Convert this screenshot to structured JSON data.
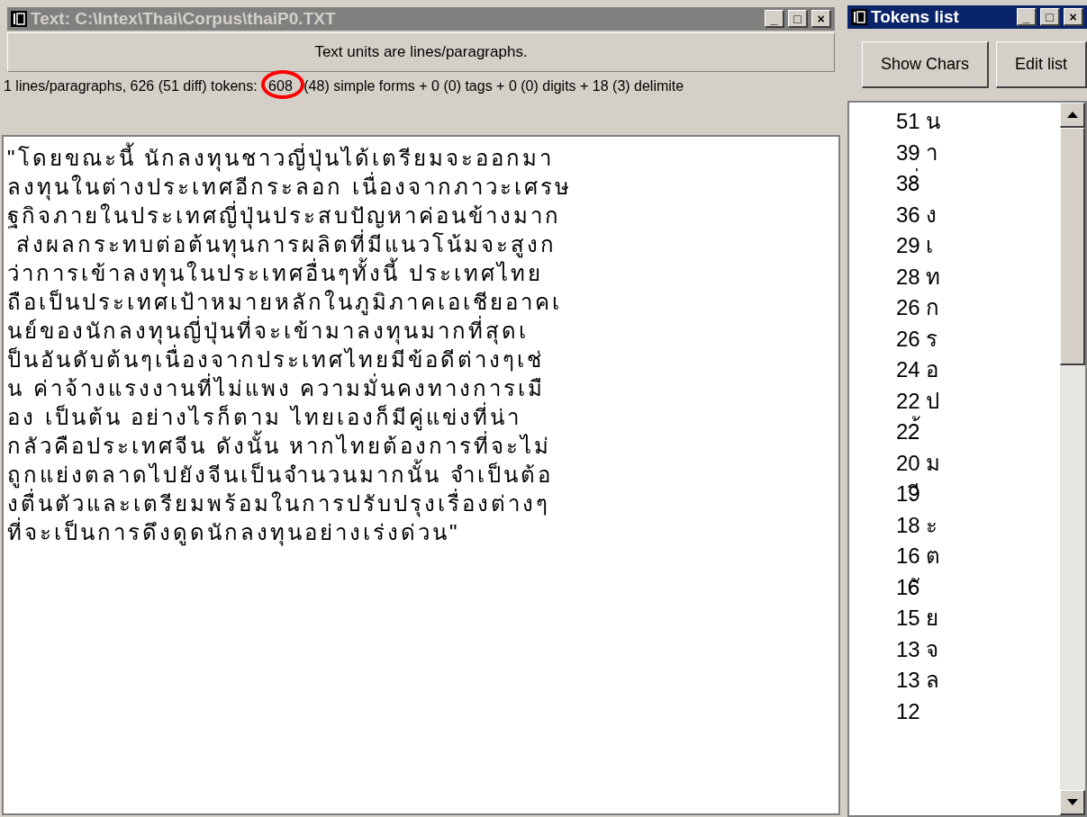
{
  "text_window": {
    "title": "Text: C:\\Intex\\Thai\\Corpus\\thaiP0.TXT",
    "active": false,
    "controls": [
      "_",
      "□",
      "×"
    ],
    "units_label": "Text units are lines/paragraphs.",
    "stats_before": "1 lines/paragraphs, 626 (51 diff) tokens: ",
    "stats_highlight": "608",
    "stats_after": " (48) simple forms + 0 (0) tags + 0 (0) digits + 18 (3) delimite",
    "lines": [
      "\"โดยขณะนี้ นักลงทุนชาวญี่ปุ่นได้เตรียมจะออกมา",
      "ลงทุนในต่างประเทศอีกระลอก เนื่องจากภาวะเศรษ",
      "ฐกิจภายในประเทศญี่ปุ่นประสบปัญหาค่อนข้างมาก",
      " ส่งผลกระทบต่อต้นทุนการผลิตที่มีแนวโน้มจะสูงก",
      "ว่าการเข้าลงทุนในประเทศอื่นๆทั้งนี้ ประเทศไทย",
      "ถือเป็นประเทศเป้าหมายหลักในภูมิภาคเอเชียอาคเ",
      "นย์ของนักลงทุนญี่ปุ่นที่จะเข้ามาลงทุนมากที่สุดเ",
      "ป็นอันดับต้นๆเนื่องจากประเทศไทยมีข้อดีต่างๆเช่",
      "น ค่าจ้างแรงงานที่ไม่แพง ความมั่นคงทางการเมื",
      "อง เป็นต้น อย่างไรก็ตาม ไทยเองก็มีคู่แข่งที่น่า",
      "กลัวคือประเทศจีน ดังนั้น หากไทยต้องการที่จะไม่",
      "ถูกแย่งตลาดไปยังจีนเป็นจำนวนมากนั้น จำเป็นต้อ",
      "งตื่นตัวและเตรียมพร้อมในการปรับปรุงเรื่องต่างๆ",
      "ที่จะเป็นการดึงดูดนักลงทุนอย่างเร่งด่วน\""
    ]
  },
  "tokens_window": {
    "title": "Tokens list",
    "active": true,
    "controls": [
      "_",
      "□",
      "×"
    ],
    "buttons": [
      "Show Chars",
      "Edit list"
    ],
    "items": [
      "51 น",
      "39 า",
      "38่",
      "36 ง",
      "29 เ",
      "28 ท",
      "26 ก",
      "26 ร",
      "24 อ",
      "22 ป",
      "22้",
      "20 ม",
      "19ี",
      "18 ะ",
      "16 ต",
      "16ั",
      "15 ย",
      "13 จ",
      "13 ล",
      "12"
    ]
  }
}
